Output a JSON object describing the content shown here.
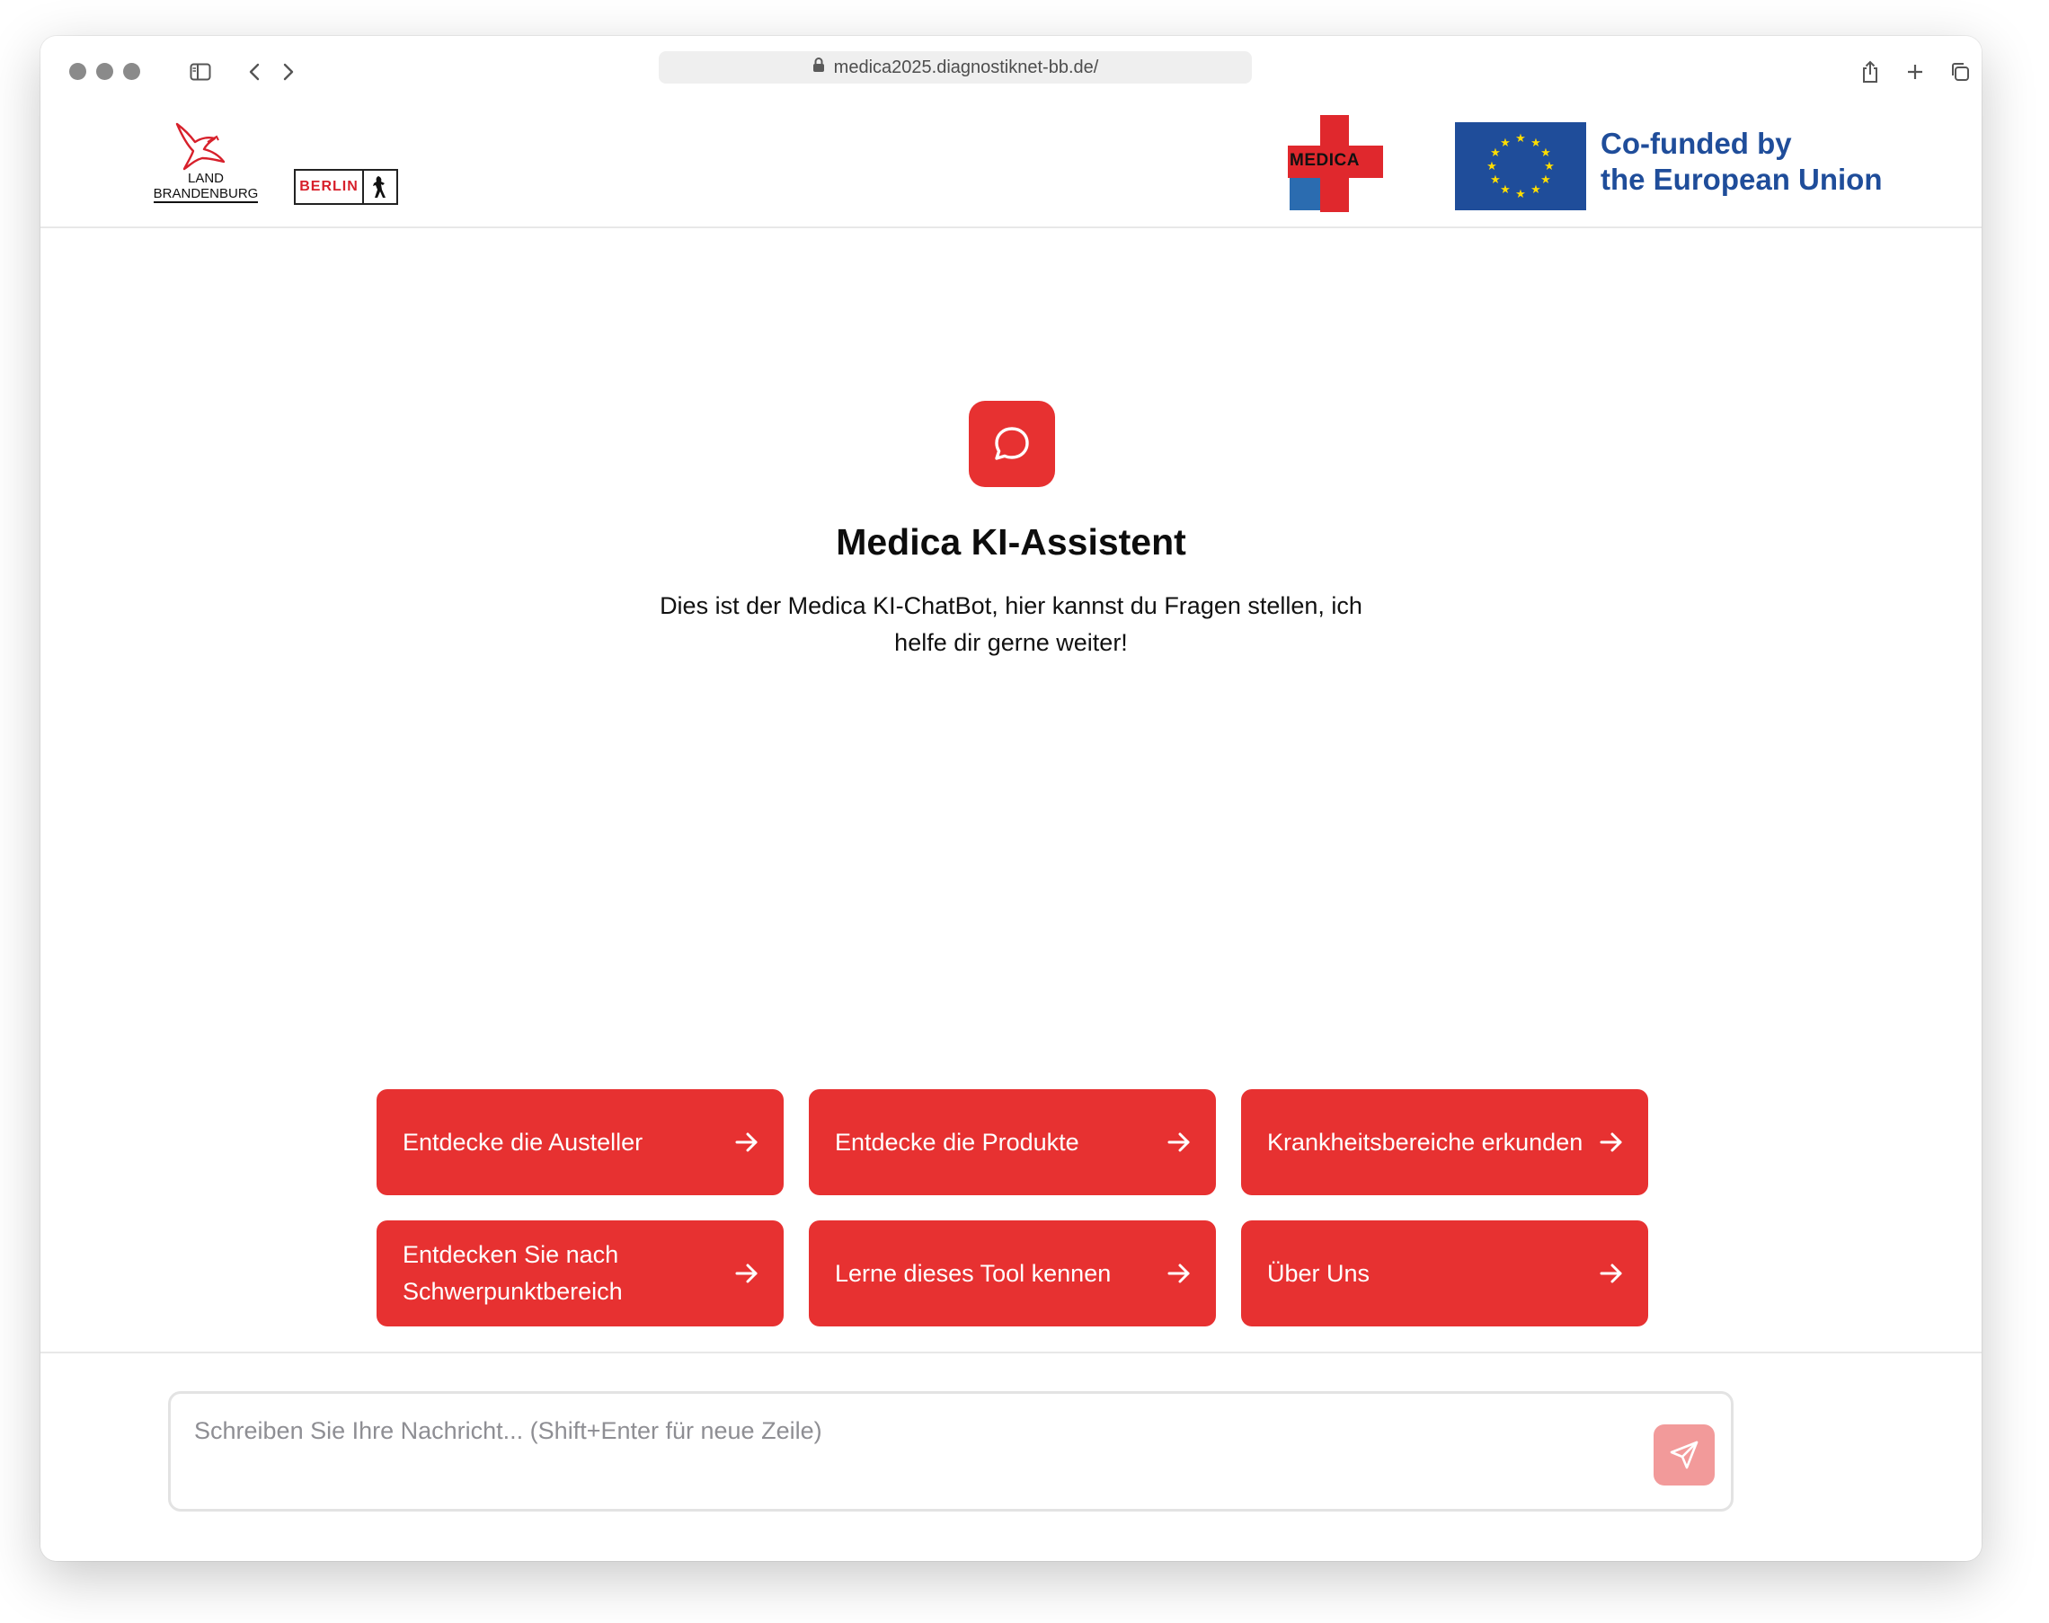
{
  "browser": {
    "url": "medica2025.diagnostiknet-bb.de/"
  },
  "header": {
    "brandenburg_line1": "LAND",
    "brandenburg_line2": "BRANDENBURG",
    "berlin_label": "BERLIN",
    "medica_label": "MEDICA",
    "eu_line1": "Co-funded by",
    "eu_line2": "the European Union"
  },
  "hero": {
    "title": "Medica KI-Assistent",
    "description": "Dies ist der Medica KI-ChatBot, hier kannst du Fragen stellen, ich helfe dir gerne weiter!"
  },
  "actions": [
    {
      "label": "Entdecke die Austeller"
    },
    {
      "label": "Entdecke die Produkte"
    },
    {
      "label": "Krankheitsbereiche erkunden"
    },
    {
      "label": "Entdecken Sie nach Schwerpunktbereich"
    },
    {
      "label": "Lerne dieses Tool kennen"
    },
    {
      "label": "Über Uns"
    }
  ],
  "composer": {
    "placeholder": "Schreiben Sie Ihre Nachricht... (Shift+Enter für neue Zeile)",
    "value": ""
  },
  "colors": {
    "brand_red": "#e73131",
    "send_disabled": "#f29a9a",
    "eu_blue": "#1f4d9a",
    "eu_star": "#ffdd00"
  },
  "icons": {
    "hero": "message-circle-icon",
    "action": "arrow-right-icon",
    "send": "send-icon"
  }
}
